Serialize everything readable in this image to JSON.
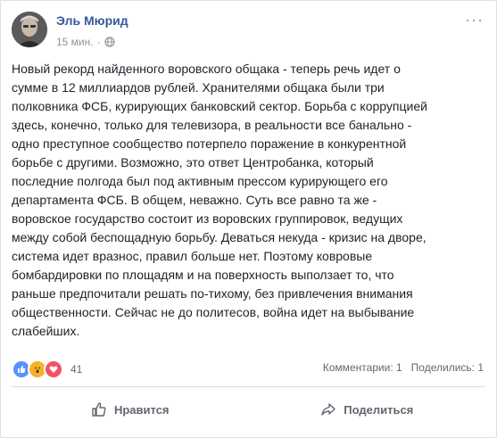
{
  "post": {
    "author": "Эль Мюрид",
    "time": "15 мин.",
    "privacy_icon": "globe-icon",
    "more_icon": "···",
    "text": "Новый рекорд найденного воровского общака - теперь речь идет о\nсумме в 12 миллиардов рублей. Хранителями общака были три\nполковника ФСБ, курирующих банковский сектор. Борьба с коррупцией\nздесь, конечно, только для телевизора, в реальности все банально -\nодно преступное сообщество потерпело поражение в конкурентной\nборьбе с другими. Возможно, это ответ Центробанка, который\nпоследние полгода был под активным прессом курирующего его\nдепартамента ФСБ. В общем, неважно. Суть все равно та же -\nворовское государство состоит из воровских группировок, ведущих\nмежду собой беспощадную борьбу. Деваться некуда - кризис на дворе,\nсистема идет вразнос, правил больше нет. Поэтому ковровые\nбомбардировки по площадям и на поверхность выползает то, что\nраньше предпочитали решать по-тихому, без привлечения внимания\nобщественности. Сейчас не до политесов, война идет на выбывание\nслабейших."
  },
  "reactions": {
    "count": "41",
    "types": [
      "like-icon",
      "wow-icon",
      "love-icon"
    ]
  },
  "stats": {
    "comments": "Комментарии: 1",
    "shares": "Поделились: 1"
  },
  "actions": {
    "like": "Нравится",
    "share": "Поделиться"
  },
  "colors": {
    "link": "#365899",
    "meta": "#90949c",
    "like": "#5890ff",
    "wow": "#f7b125",
    "love": "#f25268"
  }
}
